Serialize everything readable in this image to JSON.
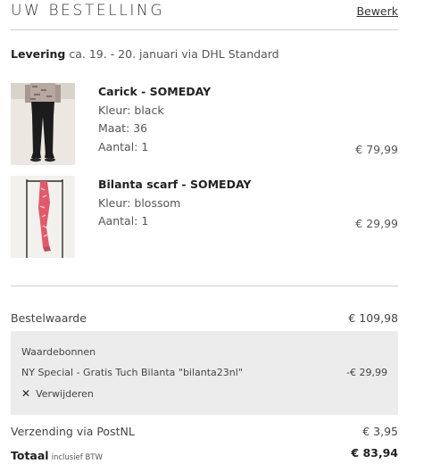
{
  "header": {
    "title": "UW BESTELLING",
    "edit_label": "Bewerk"
  },
  "delivery": {
    "label": "Levering",
    "text": "ca. 19. - 20. januari via DHL Standard"
  },
  "items": [
    {
      "name": "Carick - SOMEDAY",
      "color": "Kleur: black",
      "size": "Maat: 36",
      "qty": "Aantal: 1",
      "price": "€ 79,99"
    },
    {
      "name": "Bilanta scarf - SOMEDAY",
      "color": "Kleur: blossom",
      "qty": "Aantal: 1",
      "price": "€ 29,99"
    }
  ],
  "summary": {
    "subtotal_label": "Bestelwaarde",
    "subtotal_value": "€ 109,98",
    "voucher": {
      "title": "Waardebonnen",
      "line": "NY Special - Gratis Tuch Bilanta \"bilanta23nl\"",
      "amount": "-€ 29,99",
      "remove_label": "Verwijderen"
    },
    "shipping_label": "Verzending via PostNL",
    "shipping_value": "€ 3,95",
    "total_label": "Totaal",
    "total_sub": "inclusief BTW",
    "total_value": "€ 83,94"
  }
}
